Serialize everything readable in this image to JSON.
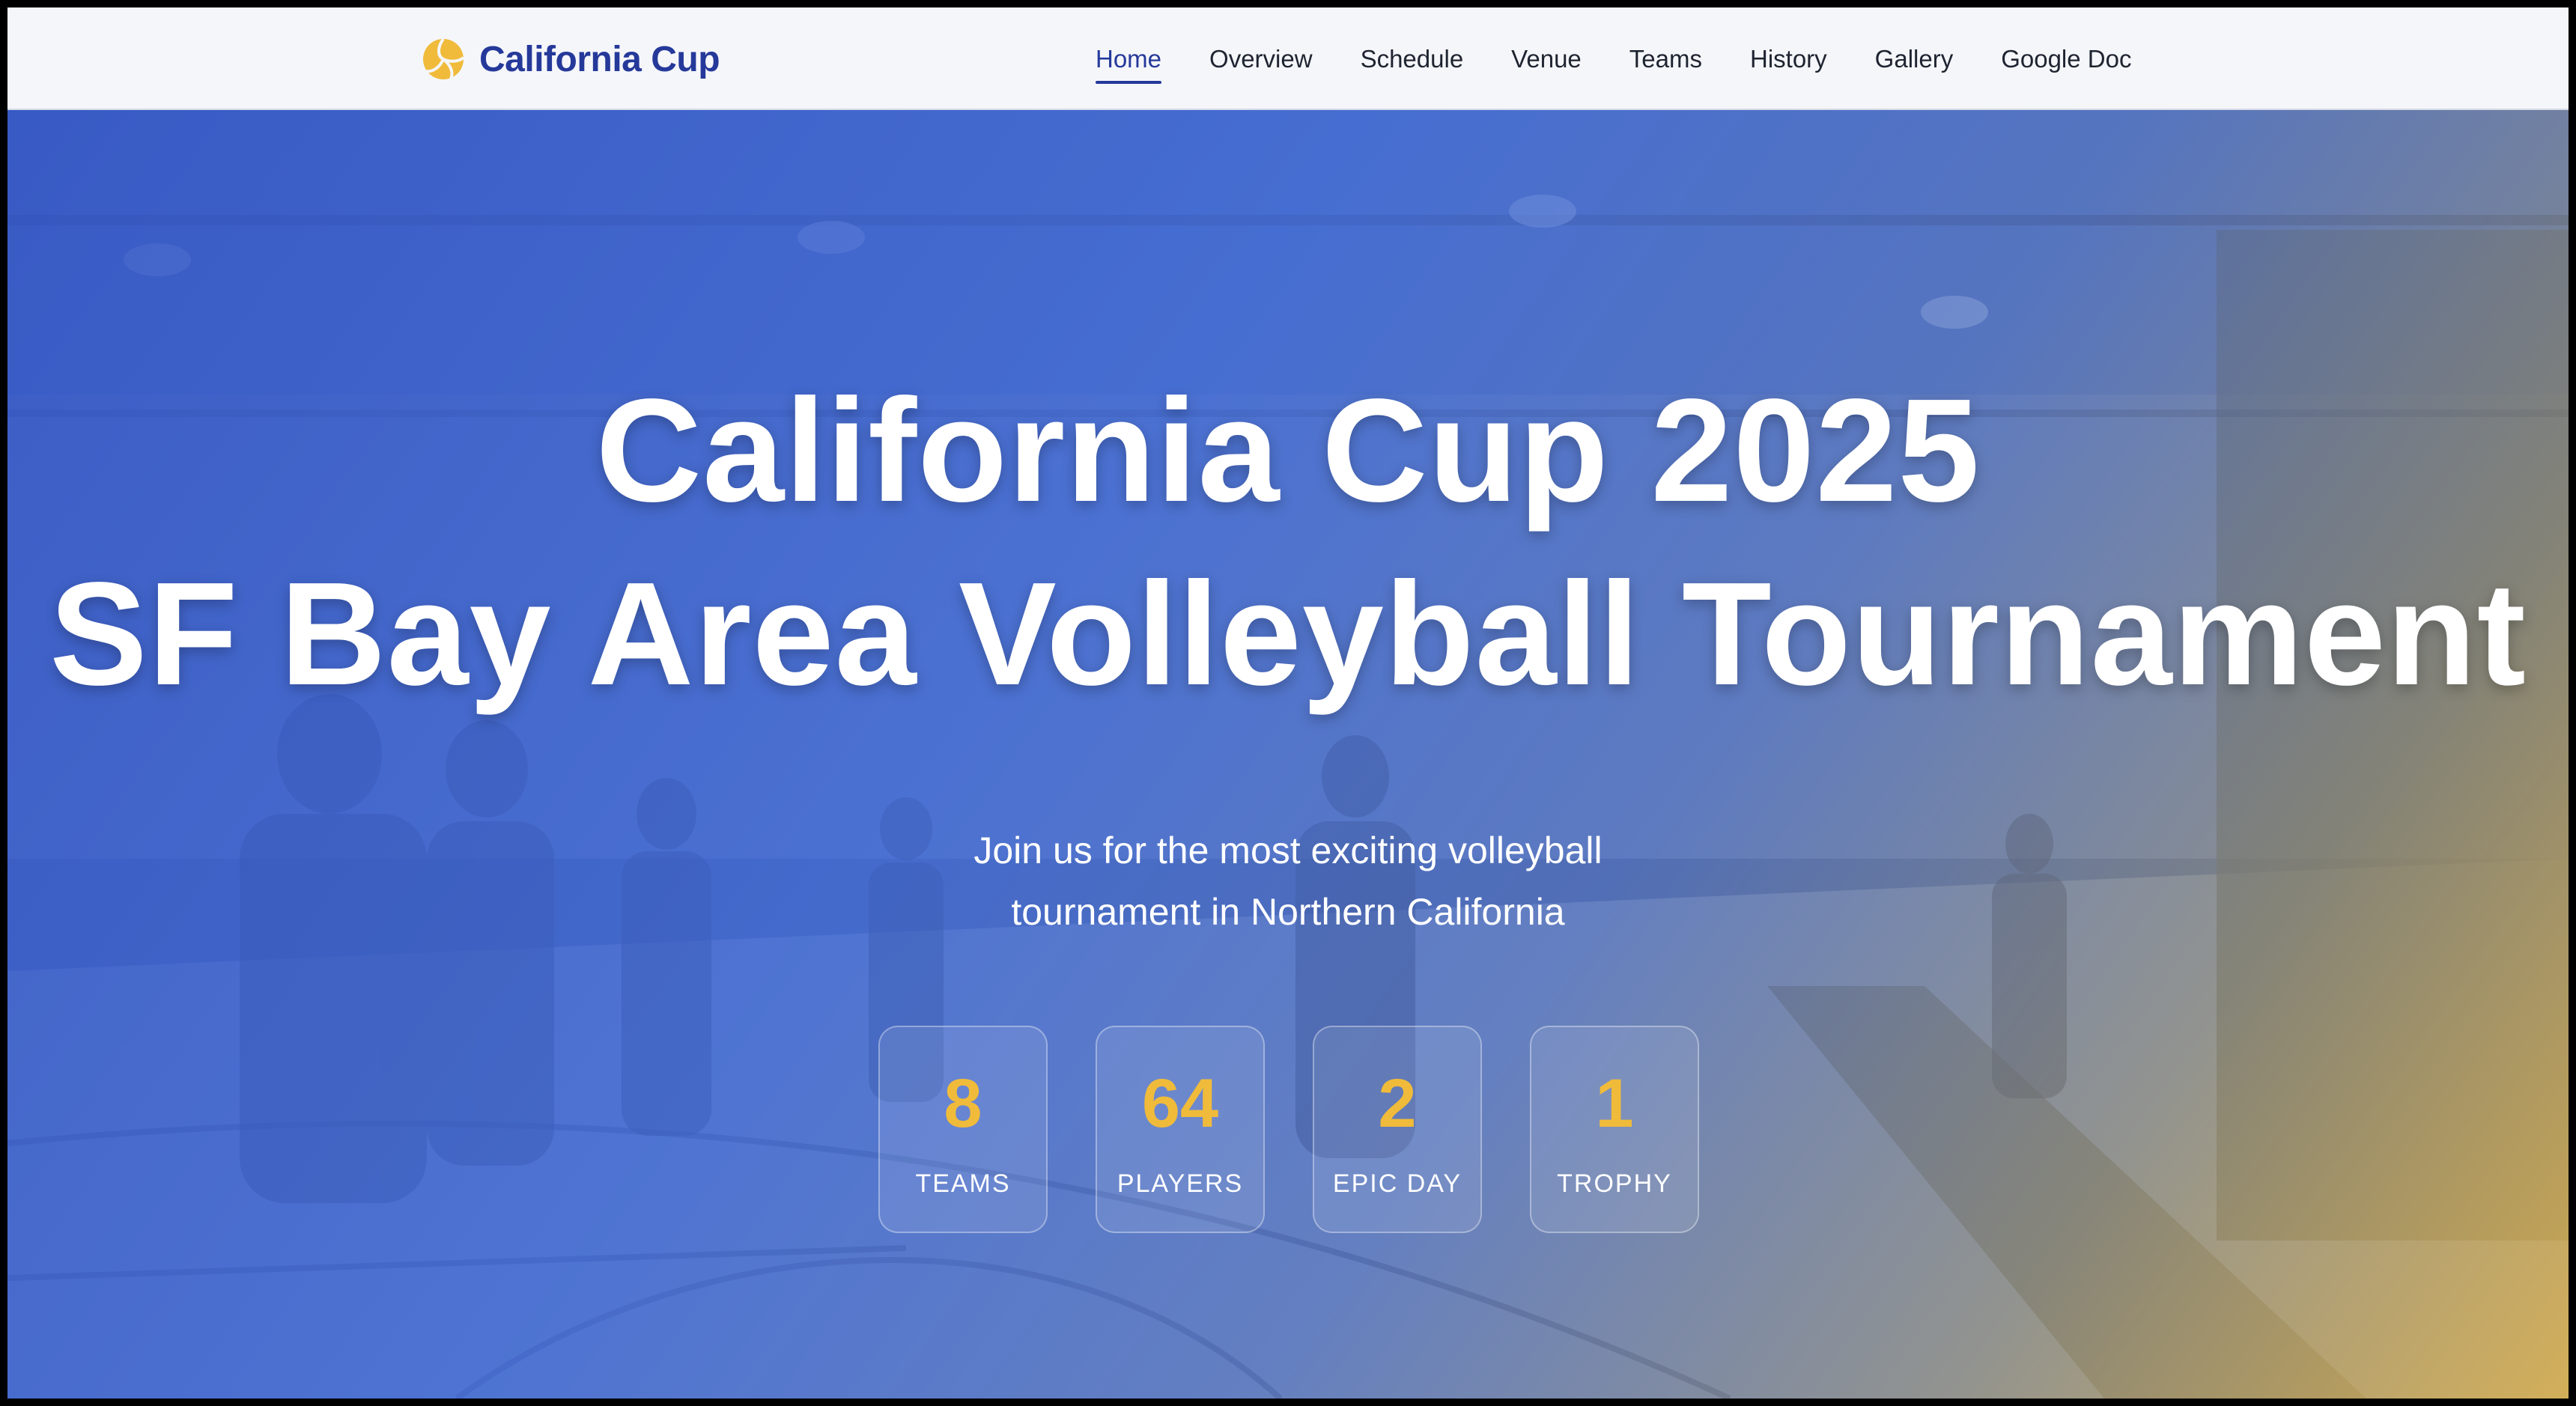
{
  "brand": {
    "name": "California Cup",
    "icon": "volleyball-icon",
    "color": "#25399a",
    "icon_color": "#f0bb3a"
  },
  "nav": {
    "items": [
      {
        "label": "Home",
        "active": true
      },
      {
        "label": "Overview"
      },
      {
        "label": "Schedule"
      },
      {
        "label": "Venue"
      },
      {
        "label": "Teams"
      },
      {
        "label": "History"
      },
      {
        "label": "Gallery"
      },
      {
        "label": "Google Doc"
      }
    ]
  },
  "hero": {
    "title_line1": "California Cup 2025",
    "title_line2": "SF Bay Area Volleyball Tournament",
    "subtitle_line1": "Join us for the most exciting volleyball",
    "subtitle_line2": "tournament in Northern California",
    "stats": [
      {
        "value": "8",
        "label": "TEAMS"
      },
      {
        "value": "64",
        "label": "PLAYERS"
      },
      {
        "value": "2",
        "label": "EPIC DAY"
      },
      {
        "value": "1",
        "label": "TROPHY"
      }
    ],
    "accent": "#f0bb3a",
    "gradient_start": "#3456c4",
    "gradient_end": "#e2b446"
  }
}
